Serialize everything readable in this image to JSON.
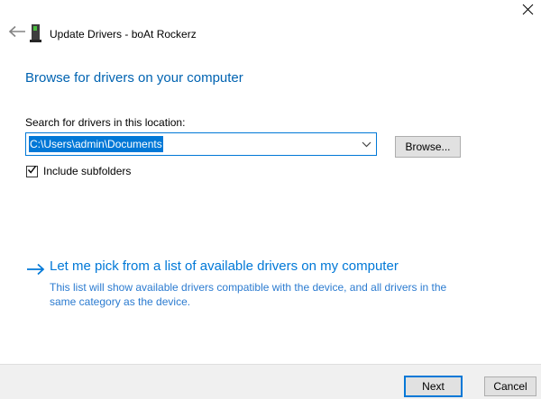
{
  "window": {
    "title": "Update Drivers - boAt Rockerz"
  },
  "content": {
    "heading": "Browse for drivers on your computer",
    "location": {
      "label": "Search for drivers in this location:",
      "path": "C:\\Users\\admin\\Documents",
      "browse_button": "Browse...",
      "include_subfolders_label": "Include subfolders",
      "include_subfolders_checked": true
    },
    "pick_link": {
      "title": "Let me pick from a list of available drivers on my computer",
      "description": "This list will show available drivers compatible with the device, and all drivers in the same category as the device."
    }
  },
  "footer": {
    "next_button": "Next",
    "cancel_button": "Cancel"
  },
  "colors": {
    "accent": "#0078d7",
    "heading_blue": "#0063b1",
    "link_blue": "#0078d7",
    "selection_bg": "#0078d7",
    "selection_text": "#ffffff",
    "footer_bg": "#f0f0f0",
    "button_bg": "#e1e1e1",
    "button_border": "#adadad",
    "device_led_green": "#4bbf3f"
  },
  "icons": {
    "close": "x-cross",
    "back": "left-arrow",
    "device": "audio-device-with-green-led",
    "chevron": "chevron-down",
    "command_arrow": "right-arrow",
    "checkbox": "checkmark"
  }
}
